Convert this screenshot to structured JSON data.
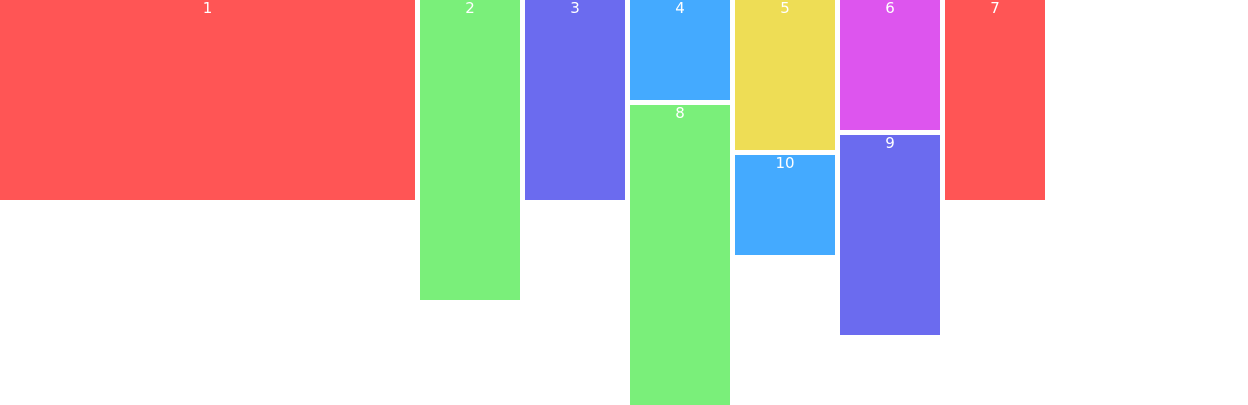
{
  "colors": {
    "red": "#ff5555",
    "green": "#7aef7a",
    "indigo": "#6b6bef",
    "sky": "#44aaff",
    "yellow": "#eedd55",
    "magenta": "#dd55ee",
    "label": "#ffffff",
    "background": "#ffffff"
  },
  "tiles": [
    {
      "id": "t1",
      "label": "1",
      "color": "#ff5555"
    },
    {
      "id": "t2",
      "label": "2",
      "color": "#7aef7a"
    },
    {
      "id": "t3",
      "label": "3",
      "color": "#6b6bef"
    },
    {
      "id": "t4",
      "label": "4",
      "color": "#44aaff"
    },
    {
      "id": "t5",
      "label": "5",
      "color": "#eedd55"
    },
    {
      "id": "t6",
      "label": "6",
      "color": "#dd55ee"
    },
    {
      "id": "t7",
      "label": "7",
      "color": "#ff5555"
    },
    {
      "id": "t8",
      "label": "8",
      "color": "#7aef7a"
    },
    {
      "id": "t9",
      "label": "9",
      "color": "#6b6bef"
    },
    {
      "id": "t10",
      "label": "10",
      "color": "#44aaff"
    }
  ]
}
